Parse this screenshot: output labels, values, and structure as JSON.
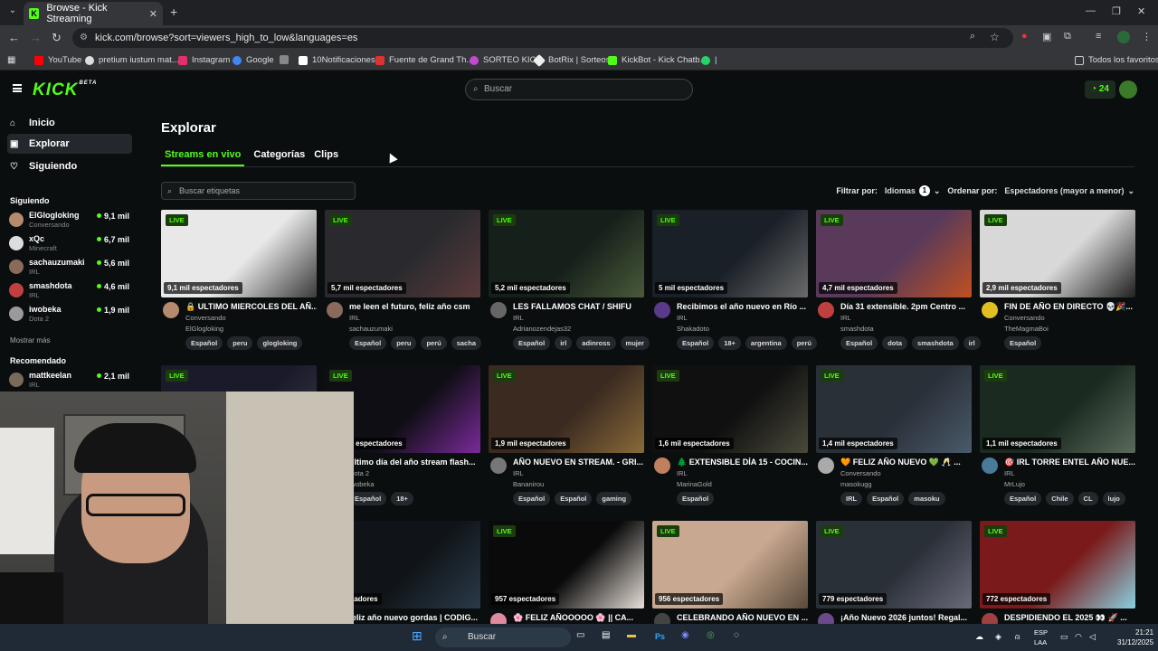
{
  "browser": {
    "tab_title": "Browse - Kick Streaming",
    "url": "kick.com/browse?sort=viewers_high_to_low&languages=es",
    "bookmarks": [
      {
        "label": "YouTube",
        "color": "#ff0000"
      },
      {
        "label": "pretium iustum mat...",
        "color": "#dddddd"
      },
      {
        "label": "Instagram",
        "color": "#e1306c"
      },
      {
        "label": "Google",
        "color": "#4285f4"
      },
      {
        "label": "",
        "color": "#888888"
      },
      {
        "label": "10Notificaciones",
        "color": "#ffffff"
      },
      {
        "label": "Fuente de Grand Th...",
        "color": "#d33"
      },
      {
        "label": "SORTEO KICK",
        "color": "#c14ad1"
      },
      {
        "label": "BotRix | Sorteos",
        "color": "#eeeeee"
      },
      {
        "label": "KickBot - Kick Chatb...",
        "color": "#53fc18"
      },
      {
        "label": "|",
        "color": "#25d366"
      }
    ],
    "all_favorites": "Todos los favoritos"
  },
  "header": {
    "logo": "KICK",
    "logo_sup": "BETA",
    "search_placeholder": "Buscar",
    "points": "24"
  },
  "sidebar": {
    "nav": [
      {
        "label": "Inicio",
        "icon": "home-icon"
      },
      {
        "label": "Explorar",
        "icon": "compass-icon"
      },
      {
        "label": "Siguiendo",
        "icon": "heart-icon"
      }
    ],
    "following_title": "Siguiendo",
    "following": [
      {
        "name": "ElGlogloking",
        "category": "Conversando",
        "viewers": "9,1 mil",
        "color": "#b58a6e"
      },
      {
        "name": "xQc",
        "category": "Minecraft",
        "viewers": "6,7 mil",
        "color": "#ddd"
      },
      {
        "name": "sachauzumaki",
        "category": "IRL",
        "viewers": "5,6 mil",
        "color": "#8a6a5a"
      },
      {
        "name": "smashdota",
        "category": "IRL",
        "viewers": "4,6 mil",
        "color": "#c04040"
      },
      {
        "name": "iwobeka",
        "category": "Dota 2",
        "viewers": "1,9 mil",
        "color": "#9a9a9a"
      }
    ],
    "show_more": "Mostrar más",
    "recommended_title": "Recomendado",
    "recommended": [
      {
        "name": "mattkeelan",
        "category": "IRL",
        "viewers": "2,1 mil",
        "color": "#7a6a5a"
      }
    ]
  },
  "main": {
    "title": "Explorar",
    "tabs": [
      "Streams en vivo",
      "Categorías",
      "Clips"
    ],
    "tag_search_placeholder": "Buscar etiquetas",
    "filter_label": "Filtrar por:",
    "languages_label": "Idiomas",
    "languages_count": "1",
    "sort_label": "Ordenar por:",
    "sort_value": "Espectadores (mayor a menor)",
    "live_label": "LIVE",
    "streams": [
      {
        "title": "🔒 ULTIMO MIERCOLES DEL AÑ...",
        "category": "Conversando",
        "streamer": "ElGlogloking",
        "viewers": "9,1 mil espectadores",
        "tags": [
          "Español",
          "peru",
          "glogloking"
        ],
        "thumb": "#e8e8e8",
        "thumb2": "#3a3a3a",
        "avatar": "#b58a6e"
      },
      {
        "title": "me leen el futuro, feliz año csm",
        "category": "IRL",
        "streamer": "sachauzumaki",
        "viewers": "5,7 mil espectadores",
        "tags": [
          "Español",
          "peru",
          "perú",
          "sacha"
        ],
        "thumb": "#2a2a2e",
        "thumb2": "#5a3a3a",
        "avatar": "#8a6a5a"
      },
      {
        "title": "LES FALLAMOS CHAT / SHIFU",
        "category": "IRL",
        "streamer": "Adrianozendejas32",
        "viewers": "5,2 mil espectadores",
        "tags": [
          "Español",
          "irl",
          "adinross",
          "mujer"
        ],
        "thumb": "#15201a",
        "thumb2": "#4a5a3a",
        "avatar": "#666"
      },
      {
        "title": "Recibimos el año nuevo en Río ...",
        "category": "IRL",
        "streamer": "Shakadoto",
        "viewers": "5 mil espectadores",
        "tags": [
          "Español",
          "18+",
          "argentina",
          "perú"
        ],
        "thumb": "#1a2028",
        "thumb2": "#6a6a6a",
        "avatar": "#5a3a8a"
      },
      {
        "title": "Día 31 extensible. 2pm Centro ...",
        "category": "IRL",
        "streamer": "smashdota",
        "viewers": "4,7 mil espectadores",
        "tags": [
          "Español",
          "dota",
          "smashdota",
          "irl"
        ],
        "thumb": "#5a3a5a",
        "thumb2": "#c05020",
        "avatar": "#c04040"
      },
      {
        "title": "FIN DE AÑO EN DIRECTO 💀🎉...",
        "category": "Conversando",
        "streamer": "TheMagmaBoi",
        "viewers": "2,9 mil espectadores",
        "tags": [
          "Español"
        ],
        "thumb": "#d8d8d8",
        "thumb2": "#202020",
        "avatar": "#e0c020"
      },
      {
        "title": "",
        "category": "",
        "streamer": "",
        "viewers": "",
        "tags": [],
        "thumb": "#1a1a2a",
        "thumb2": "#3a3a4a",
        "avatar": "#444"
      },
      {
        "title": "último día del año stream flash...",
        "category": "Dota 2",
        "streamer": "iwobeka",
        "viewers": "1,9 mil espectadores",
        "tags": [
          "Español",
          "18+"
        ],
        "thumb": "#0e0e14",
        "thumb2": "#7a2a9a",
        "avatar": "#9a9a9a"
      },
      {
        "title": "AÑO NUEVO EN STREAM. - GRI...",
        "category": "IRL",
        "streamer": "Bananirou",
        "viewers": "1,9 mil espectadores",
        "tags": [
          "Español",
          "Español",
          "gaming"
        ],
        "thumb": "#3a2a20",
        "thumb2": "#8a6a3a",
        "avatar": "#777"
      },
      {
        "title": "🌲 EXTENSIBLE DÍA 15 - COCIN...",
        "category": "IRL",
        "streamer": "MarinaGold",
        "viewers": "1,6 mil espectadores",
        "tags": [
          "Español"
        ],
        "thumb": "#101010",
        "thumb2": "#4a4a3a",
        "avatar": "#c08060"
      },
      {
        "title": "🧡 FELIZ AÑO NUEVO 💚 🥂 ...",
        "category": "Conversando",
        "streamer": "masokugg",
        "viewers": "1,4 mil espectadores",
        "tags": [
          "IRL",
          "Español",
          "masoku"
        ],
        "thumb": "#2a3038",
        "thumb2": "#4a5a6a",
        "avatar": "#aaa"
      },
      {
        "title": "🎯 IRL TORRE ENTEL AÑO NUE...",
        "category": "IRL",
        "streamer": "MrLujo",
        "viewers": "1,1 mil espectadores",
        "tags": [
          "Español",
          "Chile",
          "CL",
          "lujo"
        ],
        "thumb": "#1a2a20",
        "thumb2": "#5a6a5a",
        "avatar": "#4a7a9a"
      },
      {
        "title": "",
        "category": "",
        "streamer": "",
        "viewers": "",
        "tags": [],
        "thumb": "#222",
        "thumb2": "#333",
        "avatar": "#444"
      },
      {
        "title": "feliz año nuevo gordas | CODIG...",
        "category": "",
        "streamer": "",
        "viewers": "espectadores",
        "tags": [],
        "thumb": "#101418",
        "thumb2": "#2a3a4a",
        "avatar": "#444"
      },
      {
        "title": "🌸 FELIZ AÑOOOOO 🌸 || CA...",
        "category": "",
        "streamer": "",
        "viewers": "957 espectadores",
        "tags": [],
        "thumb": "#0a0a0a",
        "thumb2": "#e8e0d8",
        "avatar": "#e08aa0"
      },
      {
        "title": "CELEBRANDO AÑO NUEVO EN ...",
        "category": "",
        "streamer": "",
        "viewers": "956 espectadores",
        "tags": [],
        "thumb": "#c8a890",
        "thumb2": "#5a4a3a",
        "avatar": "#444"
      },
      {
        "title": "¡Año Nuevo 2026 juntos! Regal...",
        "category": "",
        "streamer": "",
        "viewers": "779 espectadores",
        "tags": [],
        "thumb": "#2a3038",
        "thumb2": "#6a6a7a",
        "avatar": "#6a4a8a"
      },
      {
        "title": "DESPIDIENDO EL 2025 👀 🚀 ...",
        "category": "",
        "streamer": "",
        "viewers": "772 espectadores",
        "tags": [],
        "thumb": "#7a1a1a",
        "thumb2": "#8ad0e0",
        "avatar": "#a04040"
      }
    ]
  },
  "taskbar": {
    "search": "Buscar",
    "lang1": "ESP",
    "lang2": "LAA",
    "time": "21:21",
    "date": "31/12/2025"
  }
}
